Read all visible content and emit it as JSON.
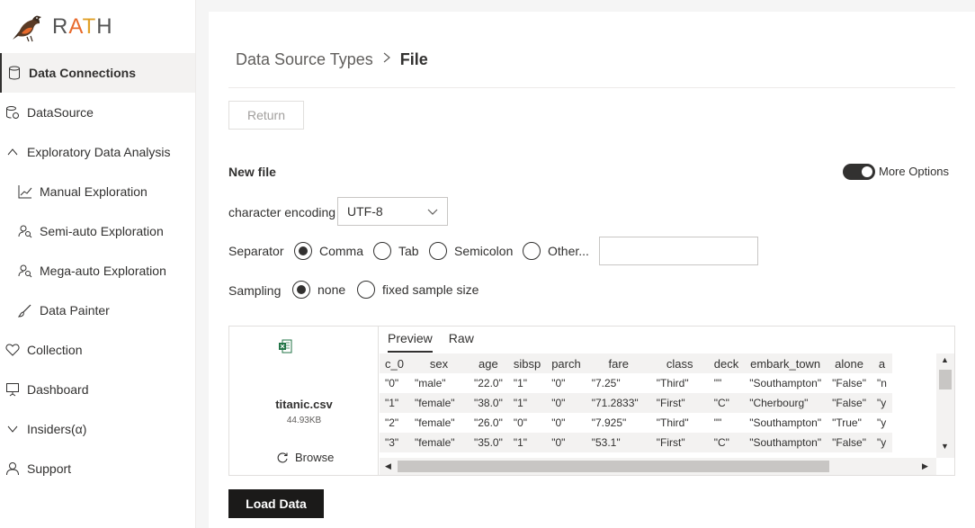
{
  "app": {
    "name_r": "R",
    "name_a": "A",
    "name_t": "T",
    "name_h": "H"
  },
  "sidebar": {
    "items": [
      {
        "label": "Data Connections",
        "icon": "database-icon"
      },
      {
        "label": "DataSource",
        "icon": "datasource-icon"
      },
      {
        "label": "Exploratory Data Analysis",
        "icon": "chevron-up-icon"
      },
      {
        "label": "Manual Exploration",
        "icon": "line-chart-icon"
      },
      {
        "label": "Semi-auto Exploration",
        "icon": "user-search-icon"
      },
      {
        "label": "Mega-auto Exploration",
        "icon": "user-search-icon"
      },
      {
        "label": "Data Painter",
        "icon": "brush-icon"
      },
      {
        "label": "Collection",
        "icon": "heart-icon"
      },
      {
        "label": "Dashboard",
        "icon": "presentation-icon"
      },
      {
        "label": "Insiders(α)",
        "icon": "chevron-down-icon"
      },
      {
        "label": "Support",
        "icon": "person-icon"
      }
    ]
  },
  "breadcrumb": {
    "parent": "Data Source Types",
    "current": "File"
  },
  "buttons": {
    "return": "Return",
    "load": "Load Data"
  },
  "new_file": {
    "title": "New file",
    "more_options": "More Options",
    "more_options_on": true
  },
  "encoding": {
    "label": "character encoding",
    "value": "UTF-8"
  },
  "separator": {
    "label": "Separator",
    "options": [
      "Comma",
      "Tab",
      "Semicolon",
      "Other..."
    ],
    "selected": "Comma",
    "other_value": ""
  },
  "sampling": {
    "label": "Sampling",
    "options": [
      "none",
      "fixed sample size"
    ],
    "selected": "none"
  },
  "file": {
    "name": "titanic.csv",
    "size": "44.93KB",
    "browse": "Browse"
  },
  "preview": {
    "tabs": [
      "Preview",
      "Raw"
    ],
    "active_tab": "Preview",
    "columns": [
      "c_0",
      "sex",
      "age",
      "sibsp",
      "parch",
      "fare",
      "class",
      "deck",
      "embark_town",
      "alone",
      "a"
    ],
    "rows": [
      [
        "\"0\"",
        "\"male\"",
        "\"22.0\"",
        "\"1\"",
        "\"0\"",
        "\"7.25\"",
        "\"Third\"",
        "\"\"",
        "\"Southampton\"",
        "\"False\"",
        "\"n"
      ],
      [
        "\"1\"",
        "\"female\"",
        "\"38.0\"",
        "\"1\"",
        "\"0\"",
        "\"71.2833\"",
        "\"First\"",
        "\"C\"",
        "\"Cherbourg\"",
        "\"False\"",
        "\"y"
      ],
      [
        "\"2\"",
        "\"female\"",
        "\"26.0\"",
        "\"0\"",
        "\"0\"",
        "\"7.925\"",
        "\"Third\"",
        "\"\"",
        "\"Southampton\"",
        "\"True\"",
        "\"y"
      ],
      [
        "\"3\"",
        "\"female\"",
        "\"35.0\"",
        "\"1\"",
        "\"0\"",
        "\"53.1\"",
        "\"First\"",
        "\"C\"",
        "\"Southampton\"",
        "\"False\"",
        "\"y"
      ]
    ]
  },
  "colors": {
    "accent": "#323130",
    "active_bg": "#f3f2f1",
    "excel_green": "#217346"
  }
}
